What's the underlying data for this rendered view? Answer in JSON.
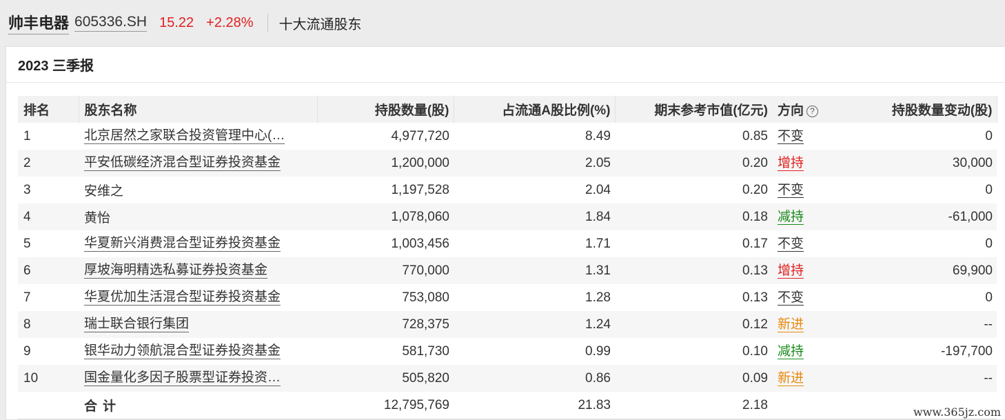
{
  "header": {
    "stock_name": "帅丰电器",
    "stock_code": "605336.SH",
    "price": "15.22",
    "change": "+2.28%",
    "section": "十大流通股东"
  },
  "panel": {
    "title": "2023 三季报"
  },
  "table": {
    "columns": [
      "排名",
      "股东名称",
      "持股数量(股)",
      "占流通A股比例(%)",
      "期末参考市值(亿元)",
      "方向",
      "持股数量变动(股)"
    ],
    "rows": [
      {
        "rank": "1",
        "name": "北京居然之家联合投资管理中心(…",
        "shares": "4,977,720",
        "ratio": "8.49",
        "value": "0.85",
        "direction": "不变",
        "change": "0"
      },
      {
        "rank": "2",
        "name": "平安低碳经济混合型证券投资基金",
        "shares": "1,200,000",
        "ratio": "2.05",
        "value": "0.20",
        "direction": "增持",
        "change": "30,000"
      },
      {
        "rank": "3",
        "name": "安维之",
        "shares": "1,197,528",
        "ratio": "2.04",
        "value": "0.20",
        "direction": "不变",
        "change": "0"
      },
      {
        "rank": "4",
        "name": "黄怡",
        "shares": "1,078,060",
        "ratio": "1.84",
        "value": "0.18",
        "direction": "减持",
        "change": "-61,000"
      },
      {
        "rank": "5",
        "name": "华夏新兴消费混合型证券投资基金",
        "shares": "1,003,456",
        "ratio": "1.71",
        "value": "0.17",
        "direction": "不变",
        "change": "0"
      },
      {
        "rank": "6",
        "name": "厚坡海明精选私募证券投资基金",
        "shares": "770,000",
        "ratio": "1.31",
        "value": "0.13",
        "direction": "增持",
        "change": "69,900"
      },
      {
        "rank": "7",
        "name": "华夏优加生活混合型证券投资基金",
        "shares": "753,080",
        "ratio": "1.28",
        "value": "0.13",
        "direction": "不变",
        "change": "0"
      },
      {
        "rank": "8",
        "name": "瑞士联合银行集团",
        "shares": "728,375",
        "ratio": "1.24",
        "value": "0.12",
        "direction": "新进",
        "change": "--"
      },
      {
        "rank": "9",
        "name": "银华动力领航混合型证券投资基金",
        "shares": "581,730",
        "ratio": "0.99",
        "value": "0.10",
        "direction": "减持",
        "change": "-197,700"
      },
      {
        "rank": "10",
        "name": "国金量化多因子股票型证券投资…",
        "shares": "505,820",
        "ratio": "0.86",
        "value": "0.09",
        "direction": "新进",
        "change": "--"
      }
    ],
    "total": {
      "label": "合计",
      "shares": "12,795,769",
      "ratio": "21.83",
      "value": "2.18"
    }
  },
  "colors": {
    "up": "#e02020",
    "down": "#1a8a1a",
    "new": "#e8890c",
    "same": "#333333"
  },
  "icons": {
    "help": "question-circle-icon"
  },
  "watermark": "www.365jz.com"
}
